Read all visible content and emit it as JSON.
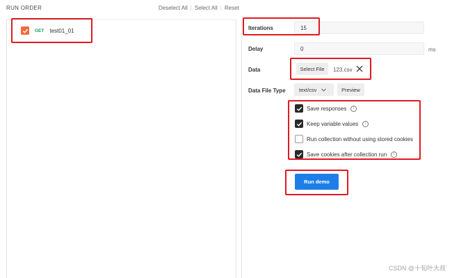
{
  "header": {
    "title": "RUN ORDER",
    "deselect_all": "Deselect All",
    "select_all": "Select All",
    "reset": "Reset"
  },
  "requests": [
    {
      "method": "GET",
      "name": "test01_01",
      "checked": true
    }
  ],
  "settings": {
    "iterations_label": "Iterations",
    "iterations_value": "15",
    "delay_label": "Delay",
    "delay_value": "0",
    "delay_unit": "ms",
    "data_label": "Data",
    "select_file_label": "Select File",
    "file_name": "123.csv",
    "data_file_type_label": "Data File Type",
    "data_file_type_value": "text/csv",
    "preview_label": "Preview"
  },
  "options": [
    {
      "label": "Save responses",
      "checked": true,
      "info": true
    },
    {
      "label": "Keep variable values",
      "checked": true,
      "info": true
    },
    {
      "label": "Run collection without using stored cookies",
      "checked": false,
      "info": false
    },
    {
      "label": "Save cookies after collection run",
      "checked": true,
      "info": true
    }
  ],
  "run_button_label": "Run demo",
  "watermark": "CSDN @十旬叶大叔",
  "colors": {
    "accent_blue": "#1e7ee8",
    "checkbox_orange": "#f26b3a",
    "method_get_green": "#19a05a",
    "highlight_red": "#e0191f"
  }
}
